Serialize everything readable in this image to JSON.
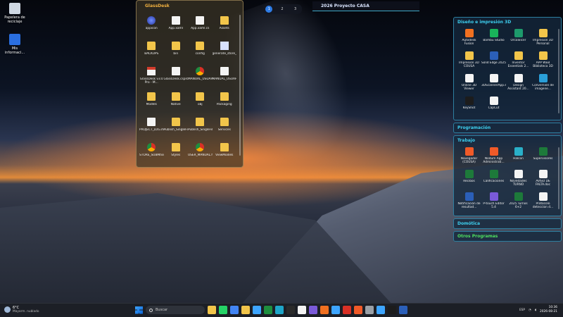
{
  "desktop_icons": [
    {
      "label": "Papelera de reciclaje",
      "icon": "recycle-bin-icon",
      "color": "#cfd8e3"
    },
    {
      "label": "Mis informaci...",
      "icon": "info-icon",
      "color": "#2a6fe0"
    }
  ],
  "glassdesk": {
    "title": "GlassDesk",
    "items": [
      {
        "label": "appicon",
        "type": "app"
      },
      {
        "label": "App.xaml",
        "type": "file"
      },
      {
        "label": "App.xaml.cs",
        "type": "file"
      },
      {
        "label": "Assets",
        "type": "folder"
      },
      {
        "label": "BACKUPS",
        "type": "folder"
      },
      {
        "label": "bin",
        "type": "folder"
      },
      {
        "label": "config",
        "type": "folder"
      },
      {
        "label": "generate_store_assets.ps1",
        "type": "script"
      },
      {
        "label": "GlassDesk v3.0 Pro - M...",
        "type": "pdf"
      },
      {
        "label": "GlassDesk.csproj",
        "type": "file"
      },
      {
        "label": "MANUAL_USUARIO.html",
        "type": "chrome"
      },
      {
        "label": "MANUAL_USUARIO.md",
        "type": "file"
      },
      {
        "label": "Models",
        "type": "folder"
      },
      {
        "label": "Native",
        "type": "folder"
      },
      {
        "label": "obj",
        "type": "folder"
      },
      {
        "label": "Packaging",
        "type": "folder"
      },
      {
        "label": "PROJECT_LOG.md",
        "type": "file"
      },
      {
        "label": "Publish_SingleFile",
        "type": "folder"
      },
      {
        "label": "Publish_SingleFile.zip",
        "type": "folder"
      },
      {
        "label": "Services",
        "type": "folder"
      },
      {
        "label": "STORE_SUBMISSION_GUI...",
        "type": "chrome"
      },
      {
        "label": "Styles",
        "type": "folder"
      },
      {
        "label": "USER_MANUAL.html",
        "type": "chrome"
      },
      {
        "label": "ViewModels",
        "type": "folder"
      }
    ]
  },
  "pager": {
    "pages": [
      "1",
      "2",
      "3"
    ],
    "active": "1"
  },
  "project_title": "2026 Proyecto CASA",
  "sidebar": {
    "sections": [
      {
        "title": "Diseño e impresión 3D",
        "color_class": "",
        "apps": [
          {
            "label": "Autodesk Fusion",
            "color": "#f07020"
          },
          {
            "label": "Bambu Studio",
            "color": "#19b45a"
          },
          {
            "label": "OrcaSlicer",
            "color": "#1d9a6c"
          },
          {
            "label": "Impresión 3D Personal",
            "color": "#f2c54a"
          },
          {
            "label": "Impresión 3D COUSA",
            "color": "#f2c54a"
          },
          {
            "label": "Solid Edge 2025",
            "color": "#2b5fb8"
          },
          {
            "label": "Inventor Essentials 2...",
            "color": "#f2c54a"
          },
          {
            "label": "APP WEB Biblioteca 3D",
            "color": "#f2c54a"
          },
          {
            "label": "Online 3D Viewer",
            "color": "#f4f4f4"
          },
          {
            "label": "3DScannerApp.exe",
            "color": "#f4f4f4"
          },
          {
            "label": "Design Assistant 20...",
            "color": "#f4f4f4"
          },
          {
            "label": "Conversión de imagene...",
            "color": "#2a9fd8"
          },
          {
            "label": "KeyShot",
            "color": "#1c1c1c"
          },
          {
            "label": "CapCut",
            "color": "#f4f4f4"
          }
        ]
      },
      {
        "title": "Programación",
        "color_class": "",
        "apps": []
      },
      {
        "title": "Trabajo",
        "color_class": "",
        "apps": [
          {
            "label": "Navegador (COUSA)",
            "color": "#f05a28"
          },
          {
            "label": "Nodum App Administrati...",
            "color": "#f05a28"
          },
          {
            "label": "Halcon",
            "color": "#2ab0c8"
          },
          {
            "label": "Supervisores",
            "color": "#1d7a3a"
          },
          {
            "label": "Recibos",
            "color": "#1d7a3a"
          },
          {
            "label": "Calificaciones",
            "color": "#1d7a3a"
          },
          {
            "label": "Novedades TURNO",
            "color": "#f4f4f4"
          },
          {
            "label": "AVISO DE FALTA.doc",
            "color": "#f4f4f4"
          },
          {
            "label": "Notificación de resultad...",
            "color": "#2b5fb8"
          },
          {
            "label": "P-touch Editor 5.4",
            "color": "#7a5ad8"
          },
          {
            "label": "2025 Turnos 6+2",
            "color": "#1d7a3a"
          },
          {
            "label": "Protocolo deteccion d...",
            "color": "#f4f4f4"
          }
        ]
      },
      {
        "title": "Domótica",
        "color_class": "",
        "apps": []
      },
      {
        "title": "Otros Programas",
        "color_class": "green",
        "apps": []
      }
    ]
  },
  "taskbar": {
    "temp": "6°C",
    "weather": "Mayorm. nublado",
    "search_placeholder": "Buscar",
    "lang": "ESP",
    "time": "10:36",
    "date": "2026-08-21",
    "apps": [
      {
        "icon": "explorer-icon",
        "color": "#f2c54a"
      },
      {
        "icon": "whatsapp-icon",
        "color": "#25d366"
      },
      {
        "icon": "chrome-icon",
        "color": "#4285f4"
      },
      {
        "icon": "files-icon",
        "color": "#f2c54a"
      },
      {
        "icon": "photos-icon",
        "color": "#3da5ff"
      },
      {
        "icon": "chrome2-icon",
        "color": "#1e8e3e"
      },
      {
        "icon": "edge-icon",
        "color": "#1ea5c8"
      },
      {
        "icon": "terminal-icon",
        "color": "#2a2a2a"
      },
      {
        "icon": "github-icon",
        "color": "#f4f4f4"
      },
      {
        "icon": "vs-icon",
        "color": "#7a5ad8"
      },
      {
        "icon": "sublime-icon",
        "color": "#f07020"
      },
      {
        "icon": "maps-icon",
        "color": "#3da5ff"
      },
      {
        "icon": "app1-icon",
        "color": "#d93025"
      },
      {
        "icon": "app2-icon",
        "color": "#f05a28"
      },
      {
        "icon": "settings-icon",
        "color": "#9aa0a6"
      },
      {
        "icon": "app3-icon",
        "color": "#3da5ff"
      },
      {
        "icon": "app4-icon",
        "color": "#1c1c1c"
      },
      {
        "icon": "app5-icon",
        "color": "#2b5fb8"
      }
    ]
  }
}
